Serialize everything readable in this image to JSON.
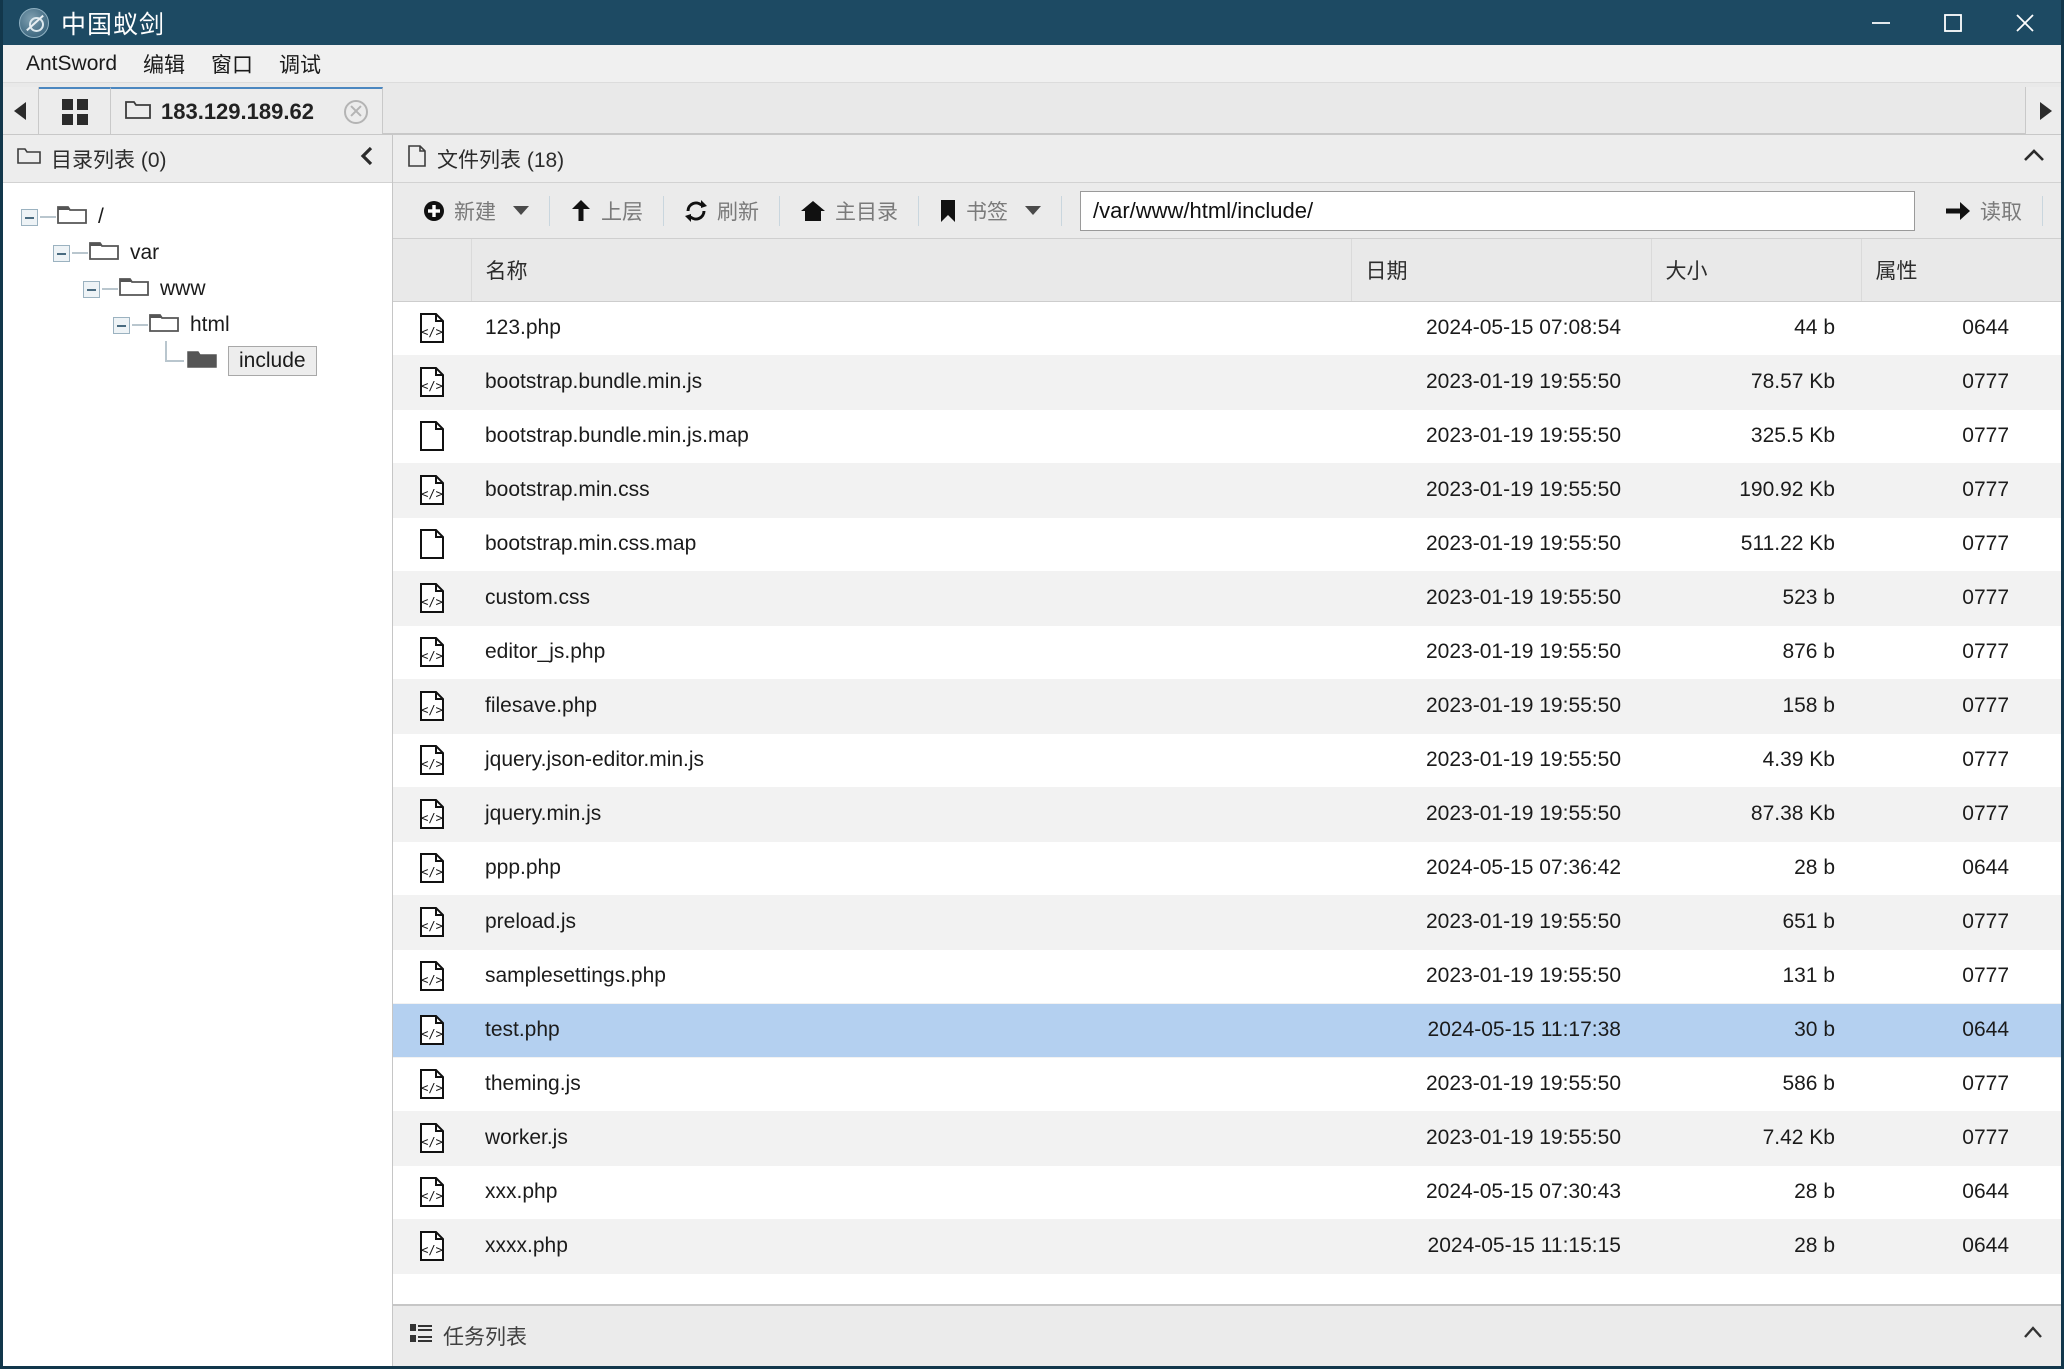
{
  "window": {
    "title": "中国蚁剑",
    "logo_icon": "antsword-logo-icon",
    "minimize_icon": "minimize-icon",
    "maximize_icon": "maximize-icon",
    "close_icon": "close-icon",
    "titlebar_color": "#1d4a63"
  },
  "menubar": {
    "items": [
      {
        "label": "AntSword"
      },
      {
        "label": "编辑"
      },
      {
        "label": "窗口"
      },
      {
        "label": "调试"
      }
    ]
  },
  "tabbar": {
    "prev_icon": "chevron-left-icon",
    "grid_icon": "grid-view-icon",
    "next_icon": "chevron-right-icon",
    "tabs": [
      {
        "label": "183.129.189.62",
        "icon": "folder-icon",
        "close_icon": "close-icon",
        "active": true
      }
    ]
  },
  "sidebar": {
    "title": "目录列表 (0)",
    "icon": "folder-icon",
    "collapse_icon": "chevron-left-icon",
    "tree": [
      {
        "label": "/",
        "depth": 0,
        "expanded": true,
        "selected": false
      },
      {
        "label": "var",
        "depth": 1,
        "expanded": true,
        "selected": false
      },
      {
        "label": "www",
        "depth": 2,
        "expanded": true,
        "selected": false
      },
      {
        "label": "html",
        "depth": 3,
        "expanded": true,
        "selected": false
      },
      {
        "label": "include",
        "depth": 4,
        "expanded": false,
        "selected": true
      }
    ]
  },
  "filepanel": {
    "title": "文件列表 (18)",
    "icon": "file-icon",
    "collapse_icon": "chevron-up-icon",
    "toolbar": {
      "new_label": "新建",
      "new_icon": "plus-circle-icon",
      "new_caret_icon": "caret-down-icon",
      "up_label": "上层",
      "up_icon": "arrow-up-icon",
      "refresh_label": "刷新",
      "refresh_icon": "refresh-icon",
      "home_label": "主目录",
      "home_icon": "home-icon",
      "bookmark_label": "书签",
      "bookmark_icon": "bookmark-icon",
      "bookmark_caret_icon": "caret-down-icon",
      "path_value": "/var/www/html/include/",
      "path_placeholder": "/var/www/html/include/",
      "read_label": "读取",
      "read_icon": "arrow-right-icon"
    },
    "columns": [
      "",
      "名称",
      "日期",
      "大小",
      "属性"
    ],
    "rows": [
      {
        "icon": "code-file-icon",
        "name": "123.php",
        "date": "2024-05-15 07:08:54",
        "size": "44 b",
        "attr": "0644",
        "selected": false
      },
      {
        "icon": "code-file-icon",
        "name": "bootstrap.bundle.min.js",
        "date": "2023-01-19 19:55:50",
        "size": "78.57 Kb",
        "attr": "0777",
        "selected": false
      },
      {
        "icon": "plain-file-icon",
        "name": "bootstrap.bundle.min.js.map",
        "date": "2023-01-19 19:55:50",
        "size": "325.5 Kb",
        "attr": "0777",
        "selected": false
      },
      {
        "icon": "code-file-icon",
        "name": "bootstrap.min.css",
        "date": "2023-01-19 19:55:50",
        "size": "190.92 Kb",
        "attr": "0777",
        "selected": false
      },
      {
        "icon": "plain-file-icon",
        "name": "bootstrap.min.css.map",
        "date": "2023-01-19 19:55:50",
        "size": "511.22 Kb",
        "attr": "0777",
        "selected": false
      },
      {
        "icon": "code-file-icon",
        "name": "custom.css",
        "date": "2023-01-19 19:55:50",
        "size": "523 b",
        "attr": "0777",
        "selected": false
      },
      {
        "icon": "code-file-icon",
        "name": "editor_js.php",
        "date": "2023-01-19 19:55:50",
        "size": "876 b",
        "attr": "0777",
        "selected": false
      },
      {
        "icon": "code-file-icon",
        "name": "filesave.php",
        "date": "2023-01-19 19:55:50",
        "size": "158 b",
        "attr": "0777",
        "selected": false
      },
      {
        "icon": "code-file-icon",
        "name": "jquery.json-editor.min.js",
        "date": "2023-01-19 19:55:50",
        "size": "4.39 Kb",
        "attr": "0777",
        "selected": false
      },
      {
        "icon": "code-file-icon",
        "name": "jquery.min.js",
        "date": "2023-01-19 19:55:50",
        "size": "87.38 Kb",
        "attr": "0777",
        "selected": false
      },
      {
        "icon": "code-file-icon",
        "name": "ppp.php",
        "date": "2024-05-15 07:36:42",
        "size": "28 b",
        "attr": "0644",
        "selected": false
      },
      {
        "icon": "code-file-icon",
        "name": "preload.js",
        "date": "2023-01-19 19:55:50",
        "size": "651 b",
        "attr": "0777",
        "selected": false
      },
      {
        "icon": "code-file-icon",
        "name": "samplesettings.php",
        "date": "2023-01-19 19:55:50",
        "size": "131 b",
        "attr": "0777",
        "selected": false
      },
      {
        "icon": "code-file-icon",
        "name": "test.php",
        "date": "2024-05-15 11:17:38",
        "size": "30 b",
        "attr": "0644",
        "selected": true
      },
      {
        "icon": "code-file-icon",
        "name": "theming.js",
        "date": "2023-01-19 19:55:50",
        "size": "586 b",
        "attr": "0777",
        "selected": false
      },
      {
        "icon": "code-file-icon",
        "name": "worker.js",
        "date": "2023-01-19 19:55:50",
        "size": "7.42 Kb",
        "attr": "0777",
        "selected": false
      },
      {
        "icon": "code-file-icon",
        "name": "xxx.php",
        "date": "2024-05-15 07:30:43",
        "size": "28 b",
        "attr": "0644",
        "selected": false
      },
      {
        "icon": "code-file-icon",
        "name": "xxxx.php",
        "date": "2024-05-15 11:15:15",
        "size": "28 b",
        "attr": "0644",
        "selected": false
      }
    ]
  },
  "taskbar": {
    "label": "任务列表",
    "icon": "task-list-icon",
    "expand_icon": "chevron-up-icon"
  },
  "colors": {
    "titlebar": "#1d4a63",
    "selection": "#b4d0f0",
    "tab_accent": "#4b87c0"
  }
}
